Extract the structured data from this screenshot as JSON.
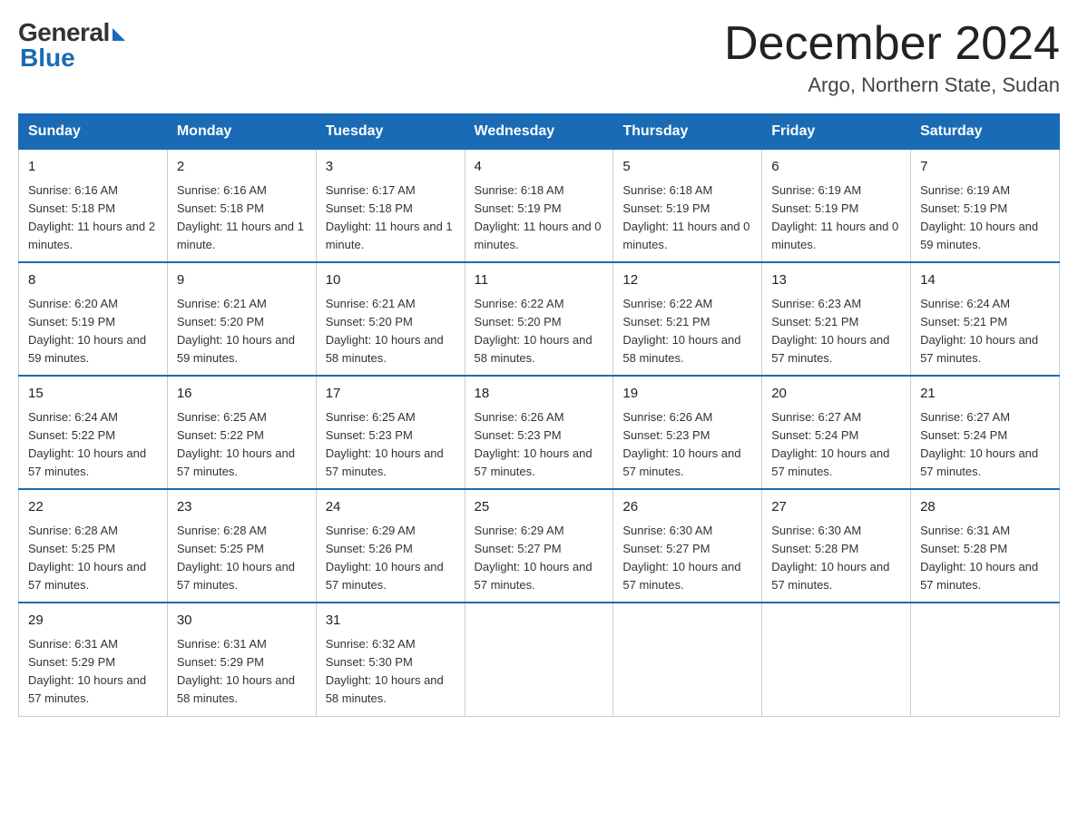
{
  "logo": {
    "general": "General",
    "blue": "Blue"
  },
  "title": {
    "month_year": "December 2024",
    "location": "Argo, Northern State, Sudan"
  },
  "days_of_week": [
    "Sunday",
    "Monday",
    "Tuesday",
    "Wednesday",
    "Thursday",
    "Friday",
    "Saturday"
  ],
  "weeks": [
    [
      {
        "num": "1",
        "sunrise": "6:16 AM",
        "sunset": "5:18 PM",
        "daylight": "11 hours and 2 minutes."
      },
      {
        "num": "2",
        "sunrise": "6:16 AM",
        "sunset": "5:18 PM",
        "daylight": "11 hours and 1 minute."
      },
      {
        "num": "3",
        "sunrise": "6:17 AM",
        "sunset": "5:18 PM",
        "daylight": "11 hours and 1 minute."
      },
      {
        "num": "4",
        "sunrise": "6:18 AM",
        "sunset": "5:19 PM",
        "daylight": "11 hours and 0 minutes."
      },
      {
        "num": "5",
        "sunrise": "6:18 AM",
        "sunset": "5:19 PM",
        "daylight": "11 hours and 0 minutes."
      },
      {
        "num": "6",
        "sunrise": "6:19 AM",
        "sunset": "5:19 PM",
        "daylight": "11 hours and 0 minutes."
      },
      {
        "num": "7",
        "sunrise": "6:19 AM",
        "sunset": "5:19 PM",
        "daylight": "10 hours and 59 minutes."
      }
    ],
    [
      {
        "num": "8",
        "sunrise": "6:20 AM",
        "sunset": "5:19 PM",
        "daylight": "10 hours and 59 minutes."
      },
      {
        "num": "9",
        "sunrise": "6:21 AM",
        "sunset": "5:20 PM",
        "daylight": "10 hours and 59 minutes."
      },
      {
        "num": "10",
        "sunrise": "6:21 AM",
        "sunset": "5:20 PM",
        "daylight": "10 hours and 58 minutes."
      },
      {
        "num": "11",
        "sunrise": "6:22 AM",
        "sunset": "5:20 PM",
        "daylight": "10 hours and 58 minutes."
      },
      {
        "num": "12",
        "sunrise": "6:22 AM",
        "sunset": "5:21 PM",
        "daylight": "10 hours and 58 minutes."
      },
      {
        "num": "13",
        "sunrise": "6:23 AM",
        "sunset": "5:21 PM",
        "daylight": "10 hours and 57 minutes."
      },
      {
        "num": "14",
        "sunrise": "6:24 AM",
        "sunset": "5:21 PM",
        "daylight": "10 hours and 57 minutes."
      }
    ],
    [
      {
        "num": "15",
        "sunrise": "6:24 AM",
        "sunset": "5:22 PM",
        "daylight": "10 hours and 57 minutes."
      },
      {
        "num": "16",
        "sunrise": "6:25 AM",
        "sunset": "5:22 PM",
        "daylight": "10 hours and 57 minutes."
      },
      {
        "num": "17",
        "sunrise": "6:25 AM",
        "sunset": "5:23 PM",
        "daylight": "10 hours and 57 minutes."
      },
      {
        "num": "18",
        "sunrise": "6:26 AM",
        "sunset": "5:23 PM",
        "daylight": "10 hours and 57 minutes."
      },
      {
        "num": "19",
        "sunrise": "6:26 AM",
        "sunset": "5:23 PM",
        "daylight": "10 hours and 57 minutes."
      },
      {
        "num": "20",
        "sunrise": "6:27 AM",
        "sunset": "5:24 PM",
        "daylight": "10 hours and 57 minutes."
      },
      {
        "num": "21",
        "sunrise": "6:27 AM",
        "sunset": "5:24 PM",
        "daylight": "10 hours and 57 minutes."
      }
    ],
    [
      {
        "num": "22",
        "sunrise": "6:28 AM",
        "sunset": "5:25 PM",
        "daylight": "10 hours and 57 minutes."
      },
      {
        "num": "23",
        "sunrise": "6:28 AM",
        "sunset": "5:25 PM",
        "daylight": "10 hours and 57 minutes."
      },
      {
        "num": "24",
        "sunrise": "6:29 AM",
        "sunset": "5:26 PM",
        "daylight": "10 hours and 57 minutes."
      },
      {
        "num": "25",
        "sunrise": "6:29 AM",
        "sunset": "5:27 PM",
        "daylight": "10 hours and 57 minutes."
      },
      {
        "num": "26",
        "sunrise": "6:30 AM",
        "sunset": "5:27 PM",
        "daylight": "10 hours and 57 minutes."
      },
      {
        "num": "27",
        "sunrise": "6:30 AM",
        "sunset": "5:28 PM",
        "daylight": "10 hours and 57 minutes."
      },
      {
        "num": "28",
        "sunrise": "6:31 AM",
        "sunset": "5:28 PM",
        "daylight": "10 hours and 57 minutes."
      }
    ],
    [
      {
        "num": "29",
        "sunrise": "6:31 AM",
        "sunset": "5:29 PM",
        "daylight": "10 hours and 57 minutes."
      },
      {
        "num": "30",
        "sunrise": "6:31 AM",
        "sunset": "5:29 PM",
        "daylight": "10 hours and 58 minutes."
      },
      {
        "num": "31",
        "sunrise": "6:32 AM",
        "sunset": "5:30 PM",
        "daylight": "10 hours and 58 minutes."
      },
      null,
      null,
      null,
      null
    ]
  ]
}
